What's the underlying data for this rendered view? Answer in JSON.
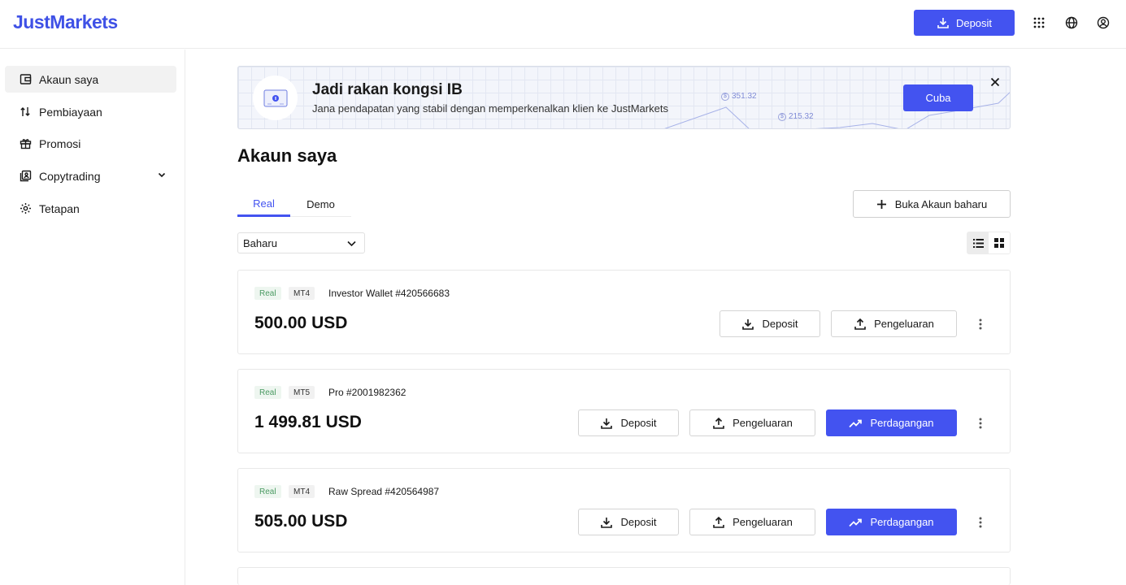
{
  "header": {
    "logo": "JustMarkets",
    "deposit_label": "Deposit",
    "icons": [
      "apps-grid-icon",
      "globe-icon",
      "user-circle-icon"
    ]
  },
  "sidebar": {
    "items": [
      {
        "label": "Akaun saya",
        "icon": "wallet-icon",
        "active": true
      },
      {
        "label": "Pembiayaan",
        "icon": "transfer-arrows-icon",
        "active": false
      },
      {
        "label": "Promosi",
        "icon": "gift-icon",
        "active": false
      },
      {
        "label": "Copytrading",
        "icon": "copytrading-icon",
        "active": false,
        "expandable": true
      },
      {
        "label": "Tetapan",
        "icon": "gear-icon",
        "active": false
      }
    ]
  },
  "banner": {
    "title": "Jadi rakan kongsi IB",
    "subtitle": "Jana pendapatan yang stabil dengan memperkenalkan klien ke JustMarkets",
    "cta_label": "Cuba",
    "chart_value_1": "351.32",
    "chart_value_2": "215.32"
  },
  "page": {
    "title": "Akaun saya",
    "tabs": [
      {
        "label": "Real",
        "active": true
      },
      {
        "label": "Demo",
        "active": false
      }
    ],
    "new_account_label": "Buka Akaun baharu",
    "sort_value": "Baharu"
  },
  "accounts": [
    {
      "type": "Real",
      "platform": "MT4",
      "name": "Investor Wallet #420566683",
      "balance": "500.00 USD",
      "deposit_label": "Deposit",
      "withdraw_label": "Pengeluaran",
      "trade_label": null
    },
    {
      "type": "Real",
      "platform": "MT5",
      "name": "Pro #2001982362",
      "balance": "1 499.81 USD",
      "deposit_label": "Deposit",
      "withdraw_label": "Pengeluaran",
      "trade_label": "Perdagangan"
    },
    {
      "type": "Real",
      "platform": "MT4",
      "name": "Raw Spread #420564987",
      "balance": "505.00 USD",
      "deposit_label": "Deposit",
      "withdraw_label": "Pengeluaran",
      "trade_label": "Perdagangan"
    }
  ],
  "colors": {
    "accent": "#4353f0",
    "real_badge_bg": "#eef6f0",
    "real_badge_text": "#4a9a62"
  }
}
